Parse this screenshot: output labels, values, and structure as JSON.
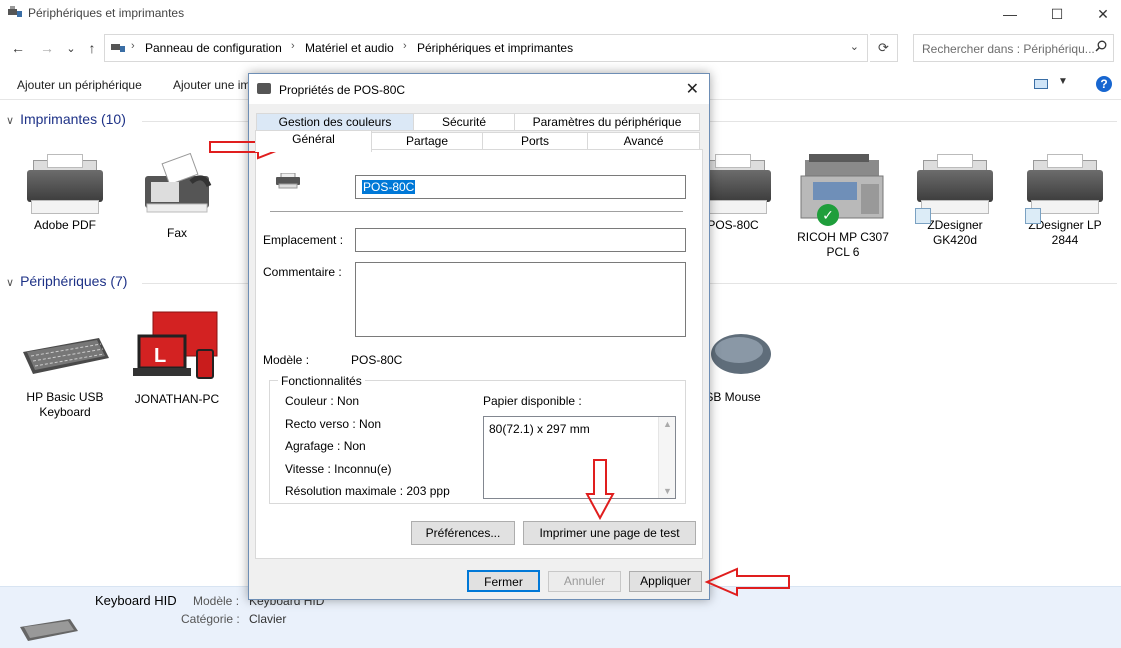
{
  "window": {
    "title": "Périphériques et imprimantes",
    "minimize": "—",
    "maximize": "☐",
    "close": "✕"
  },
  "nav": {
    "back": "←",
    "forward": "→",
    "recent": "⌄",
    "up": "↑"
  },
  "breadcrumb": [
    "Panneau de configuration",
    "Matériel et audio",
    "Périphériques et imprimantes"
  ],
  "breadcrumb_sep": "›",
  "search": {
    "placeholder": "Rechercher dans : Périphériqu..."
  },
  "toolbar": {
    "add_device": "Ajouter un périphérique",
    "add_printer": "Ajouter une im"
  },
  "sections": {
    "printers": {
      "title": "Imprimantes (10)"
    },
    "devices": {
      "title": "Périphériques (7)"
    }
  },
  "printers": [
    {
      "name": "Adobe PDF"
    },
    {
      "name": "Fax"
    },
    {
      "name": "POS-80C"
    },
    {
      "name": "RICOH MP C307",
      "name2": "PCL 6"
    },
    {
      "name": "ZDesigner",
      "name2": "GK420d"
    },
    {
      "name": "ZDesigner LP",
      "name2": "2844"
    }
  ],
  "devices": [
    {
      "name": "HP Basic USB",
      "name2": "Keyboard"
    },
    {
      "name": "JONATHAN-PC"
    },
    {
      "name": "USB Mouse",
      "visible": "SB Mouse"
    }
  ],
  "details": {
    "device_name": "Keyboard HID",
    "model_label": "Modèle :",
    "model_value": "Keyboard HID",
    "category_label": "Catégorie :",
    "category_value": "Clavier"
  },
  "dialog": {
    "title": "Propriétés de POS-80C",
    "tabs_row1": [
      "Gestion des couleurs",
      "Sécurité",
      "Paramètres du périphérique"
    ],
    "tabs_row2": [
      "Général",
      "Partage",
      "Ports",
      "Avancé"
    ],
    "printer_name": "POS-80C",
    "location_label": "Emplacement :",
    "location_value": "",
    "comment_label": "Commentaire :",
    "comment_value": "",
    "model_label": "Modèle :",
    "model_value": "POS-80C",
    "features": {
      "legend": "Fonctionnalités",
      "color": "Couleur : Non",
      "duplex": "Recto verso : Non",
      "staple": "Agrafage : Non",
      "speed": "Vitesse : Inconnu(e)",
      "resolution": "Résolution maximale : 203 ppp",
      "paper_label": "Papier disponible :",
      "paper_items": [
        "80(72.1) x 297 mm"
      ]
    },
    "preferences_btn": "Préférences...",
    "test_page_btn": "Imprimer une page de test",
    "ok_btn": "Fermer",
    "cancel_btn": "Annuler",
    "apply_btn": "Appliquer"
  },
  "colors": {
    "accent": "#0078d7",
    "section_title": "#1e3287",
    "annotation_arrow": "#e01e1e",
    "details_bg": "#eaf1fb"
  }
}
